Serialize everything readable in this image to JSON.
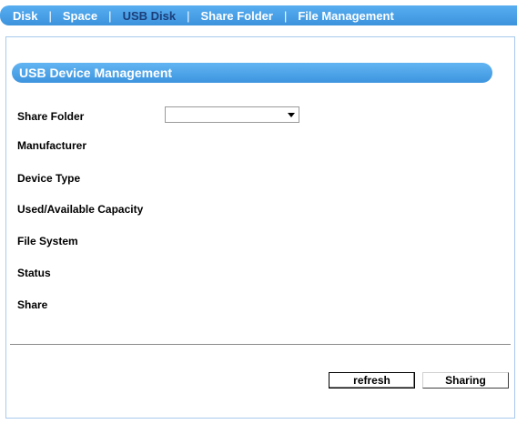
{
  "nav": {
    "items": [
      {
        "label": "Disk"
      },
      {
        "label": "Space"
      },
      {
        "label": "USB Disk"
      },
      {
        "label": "Share Folder"
      },
      {
        "label": "File Management"
      }
    ],
    "separator": "|",
    "active": "USB Disk"
  },
  "section": {
    "title": "USB Device Management"
  },
  "fields": {
    "share_folder": "Share Folder",
    "manufacturer": "Manufacturer",
    "device_type": "Device Type",
    "capacity": "Used/Available Capacity",
    "file_system": "File System",
    "status": "Status",
    "share": "Share"
  },
  "share_folder_select": {
    "value": ""
  },
  "buttons": {
    "refresh": "refresh",
    "sharing": "Sharing"
  },
  "colors": {
    "nav_bg": "#3c93dd",
    "nav_active_text": "#1b3e7a",
    "panel_border": "#a9c9ec"
  }
}
